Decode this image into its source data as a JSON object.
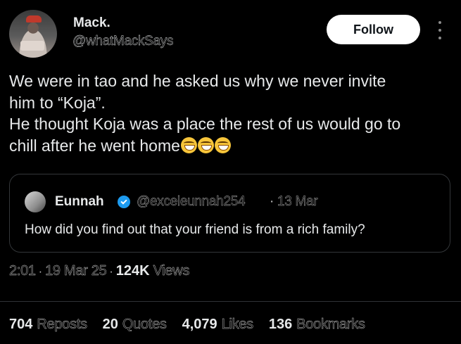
{
  "author": {
    "name": "Mack.",
    "handle": "@whatMackSays"
  },
  "actions": {
    "follow_label": "Follow"
  },
  "tweet": {
    "lines": [
      "We were in tao and he asked us why we never invite",
      "him to “Koja”.",
      "He thought Koja was a place the rest of us would go to",
      "chill after he went home"
    ],
    "emoji_count": 3
  },
  "quote": {
    "name": "Eunnah",
    "handle": "@exceleunnah254",
    "separator": "·",
    "date": "13 Mar",
    "text": "How did you find out that your friend is from a rich family?"
  },
  "meta": {
    "time": "2:01",
    "date": "19 Mar 25",
    "views_count": "124K",
    "views_label": "Views",
    "separator": "·"
  },
  "stats": {
    "reposts": {
      "count": "704",
      "label": "Reposts"
    },
    "quotes": {
      "count": "20",
      "label": "Quotes"
    },
    "likes": {
      "count": "4,079",
      "label": "Likes"
    },
    "bookmarks": {
      "count": "136",
      "label": "Bookmarks"
    }
  },
  "icons": {
    "more": "more-dots-vertical",
    "verified": "verified-badge",
    "emoji": "grinning-squinting-face"
  }
}
